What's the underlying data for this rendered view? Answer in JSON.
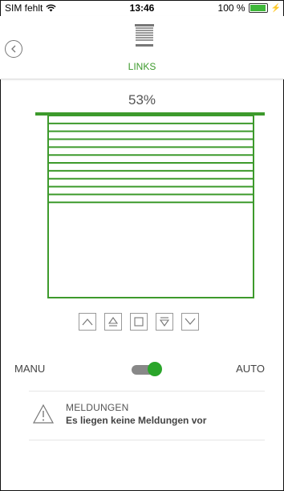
{
  "statusbar": {
    "carrier": "SIM fehlt",
    "time": "13:46",
    "battery_text": "100 %",
    "battery_level": 1.0
  },
  "header": {
    "title": "LINKS",
    "back_icon": "chevron-left-icon",
    "device_icon": "blind-icon"
  },
  "blind": {
    "percent_label": "53%",
    "closed_fraction": 0.53,
    "slat_count": 11,
    "color": "#3d9a2c"
  },
  "controls": [
    {
      "name": "up-button",
      "icon": "chevron-up-icon"
    },
    {
      "name": "up-stop-button",
      "icon": "arrow-up-bar-icon"
    },
    {
      "name": "stop-button",
      "icon": "square-icon"
    },
    {
      "name": "down-stop-button",
      "icon": "arrow-down-bar-icon"
    },
    {
      "name": "down-button",
      "icon": "chevron-down-icon"
    }
  ],
  "mode": {
    "left_label": "MANU",
    "right_label": "AUTO",
    "auto_on": true
  },
  "messages": {
    "title": "MELDUNGEN",
    "text": "Es liegen keine Meldungen vor",
    "icon": "warning-icon"
  },
  "colors": {
    "accent": "#3d9a2c",
    "toggle_on": "#2aa52a"
  }
}
